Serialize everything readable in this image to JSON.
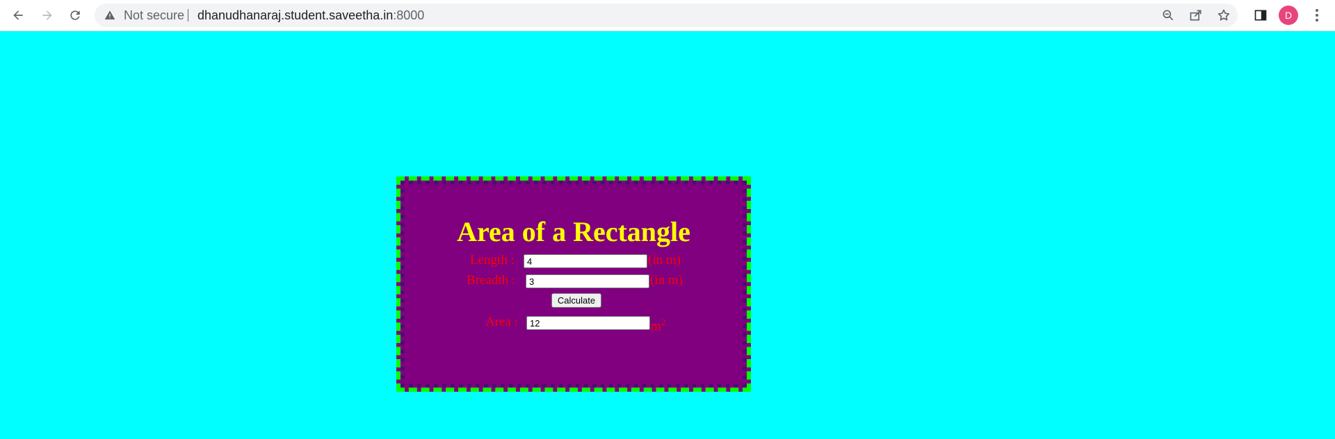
{
  "browser": {
    "security_label": "Not secure",
    "url_host": "dhanudhanaraj.student.saveetha.in",
    "url_port": ":8000",
    "profile_initial": "D",
    "icons": [
      "back-icon",
      "forward-icon",
      "reload-icon",
      "warning-icon",
      "zoom-icon",
      "share-icon",
      "bookmark-star-icon",
      "side-panel-icon",
      "profile-avatar",
      "menu-kebab-icon"
    ]
  },
  "page": {
    "background_color": "#00ffff",
    "card_color": "#800080",
    "border_color": "#00ff00",
    "title_color": "#ffff00",
    "label_color": "#ff0000"
  },
  "form": {
    "title": "Area of a Rectangle",
    "length_label": "Length :",
    "length_value": "4",
    "length_unit": "(in m)",
    "breadth_label": "Breadth :",
    "breadth_value": "3",
    "breadth_unit": "(in m)",
    "calculate_label": "Calculate",
    "area_label": "Area :",
    "area_value": "12",
    "area_unit": "m",
    "area_unit_exponent": "2"
  }
}
